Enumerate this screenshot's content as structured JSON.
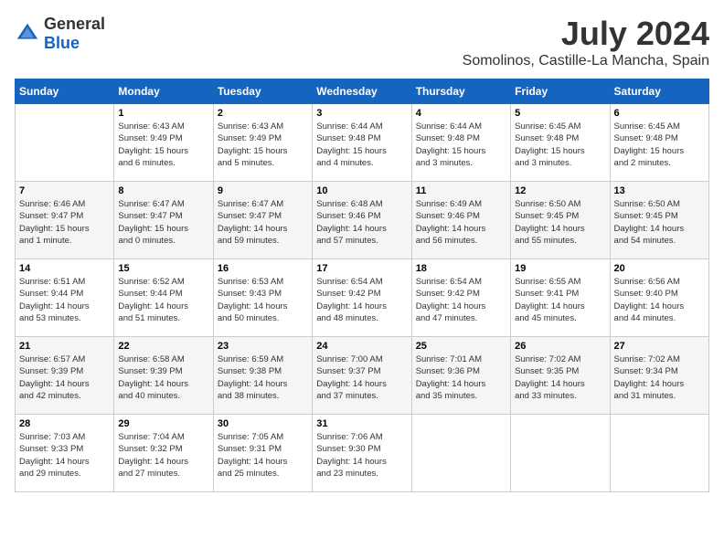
{
  "header": {
    "logo_general": "General",
    "logo_blue": "Blue",
    "month_year": "July 2024",
    "location": "Somolinos, Castille-La Mancha, Spain"
  },
  "days_of_week": [
    "Sunday",
    "Monday",
    "Tuesday",
    "Wednesday",
    "Thursday",
    "Friday",
    "Saturday"
  ],
  "weeks": [
    [
      {
        "day": "",
        "info": ""
      },
      {
        "day": "1",
        "info": "Sunrise: 6:43 AM\nSunset: 9:49 PM\nDaylight: 15 hours\nand 6 minutes."
      },
      {
        "day": "2",
        "info": "Sunrise: 6:43 AM\nSunset: 9:49 PM\nDaylight: 15 hours\nand 5 minutes."
      },
      {
        "day": "3",
        "info": "Sunrise: 6:44 AM\nSunset: 9:48 PM\nDaylight: 15 hours\nand 4 minutes."
      },
      {
        "day": "4",
        "info": "Sunrise: 6:44 AM\nSunset: 9:48 PM\nDaylight: 15 hours\nand 3 minutes."
      },
      {
        "day": "5",
        "info": "Sunrise: 6:45 AM\nSunset: 9:48 PM\nDaylight: 15 hours\nand 3 minutes."
      },
      {
        "day": "6",
        "info": "Sunrise: 6:45 AM\nSunset: 9:48 PM\nDaylight: 15 hours\nand 2 minutes."
      }
    ],
    [
      {
        "day": "7",
        "info": "Sunrise: 6:46 AM\nSunset: 9:47 PM\nDaylight: 15 hours\nand 1 minute."
      },
      {
        "day": "8",
        "info": "Sunrise: 6:47 AM\nSunset: 9:47 PM\nDaylight: 15 hours\nand 0 minutes."
      },
      {
        "day": "9",
        "info": "Sunrise: 6:47 AM\nSunset: 9:47 PM\nDaylight: 14 hours\nand 59 minutes."
      },
      {
        "day": "10",
        "info": "Sunrise: 6:48 AM\nSunset: 9:46 PM\nDaylight: 14 hours\nand 57 minutes."
      },
      {
        "day": "11",
        "info": "Sunrise: 6:49 AM\nSunset: 9:46 PM\nDaylight: 14 hours\nand 56 minutes."
      },
      {
        "day": "12",
        "info": "Sunrise: 6:50 AM\nSunset: 9:45 PM\nDaylight: 14 hours\nand 55 minutes."
      },
      {
        "day": "13",
        "info": "Sunrise: 6:50 AM\nSunset: 9:45 PM\nDaylight: 14 hours\nand 54 minutes."
      }
    ],
    [
      {
        "day": "14",
        "info": "Sunrise: 6:51 AM\nSunset: 9:44 PM\nDaylight: 14 hours\nand 53 minutes."
      },
      {
        "day": "15",
        "info": "Sunrise: 6:52 AM\nSunset: 9:44 PM\nDaylight: 14 hours\nand 51 minutes."
      },
      {
        "day": "16",
        "info": "Sunrise: 6:53 AM\nSunset: 9:43 PM\nDaylight: 14 hours\nand 50 minutes."
      },
      {
        "day": "17",
        "info": "Sunrise: 6:54 AM\nSunset: 9:42 PM\nDaylight: 14 hours\nand 48 minutes."
      },
      {
        "day": "18",
        "info": "Sunrise: 6:54 AM\nSunset: 9:42 PM\nDaylight: 14 hours\nand 47 minutes."
      },
      {
        "day": "19",
        "info": "Sunrise: 6:55 AM\nSunset: 9:41 PM\nDaylight: 14 hours\nand 45 minutes."
      },
      {
        "day": "20",
        "info": "Sunrise: 6:56 AM\nSunset: 9:40 PM\nDaylight: 14 hours\nand 44 minutes."
      }
    ],
    [
      {
        "day": "21",
        "info": "Sunrise: 6:57 AM\nSunset: 9:39 PM\nDaylight: 14 hours\nand 42 minutes."
      },
      {
        "day": "22",
        "info": "Sunrise: 6:58 AM\nSunset: 9:39 PM\nDaylight: 14 hours\nand 40 minutes."
      },
      {
        "day": "23",
        "info": "Sunrise: 6:59 AM\nSunset: 9:38 PM\nDaylight: 14 hours\nand 38 minutes."
      },
      {
        "day": "24",
        "info": "Sunrise: 7:00 AM\nSunset: 9:37 PM\nDaylight: 14 hours\nand 37 minutes."
      },
      {
        "day": "25",
        "info": "Sunrise: 7:01 AM\nSunset: 9:36 PM\nDaylight: 14 hours\nand 35 minutes."
      },
      {
        "day": "26",
        "info": "Sunrise: 7:02 AM\nSunset: 9:35 PM\nDaylight: 14 hours\nand 33 minutes."
      },
      {
        "day": "27",
        "info": "Sunrise: 7:02 AM\nSunset: 9:34 PM\nDaylight: 14 hours\nand 31 minutes."
      }
    ],
    [
      {
        "day": "28",
        "info": "Sunrise: 7:03 AM\nSunset: 9:33 PM\nDaylight: 14 hours\nand 29 minutes."
      },
      {
        "day": "29",
        "info": "Sunrise: 7:04 AM\nSunset: 9:32 PM\nDaylight: 14 hours\nand 27 minutes."
      },
      {
        "day": "30",
        "info": "Sunrise: 7:05 AM\nSunset: 9:31 PM\nDaylight: 14 hours\nand 25 minutes."
      },
      {
        "day": "31",
        "info": "Sunrise: 7:06 AM\nSunset: 9:30 PM\nDaylight: 14 hours\nand 23 minutes."
      },
      {
        "day": "",
        "info": ""
      },
      {
        "day": "",
        "info": ""
      },
      {
        "day": "",
        "info": ""
      }
    ]
  ]
}
